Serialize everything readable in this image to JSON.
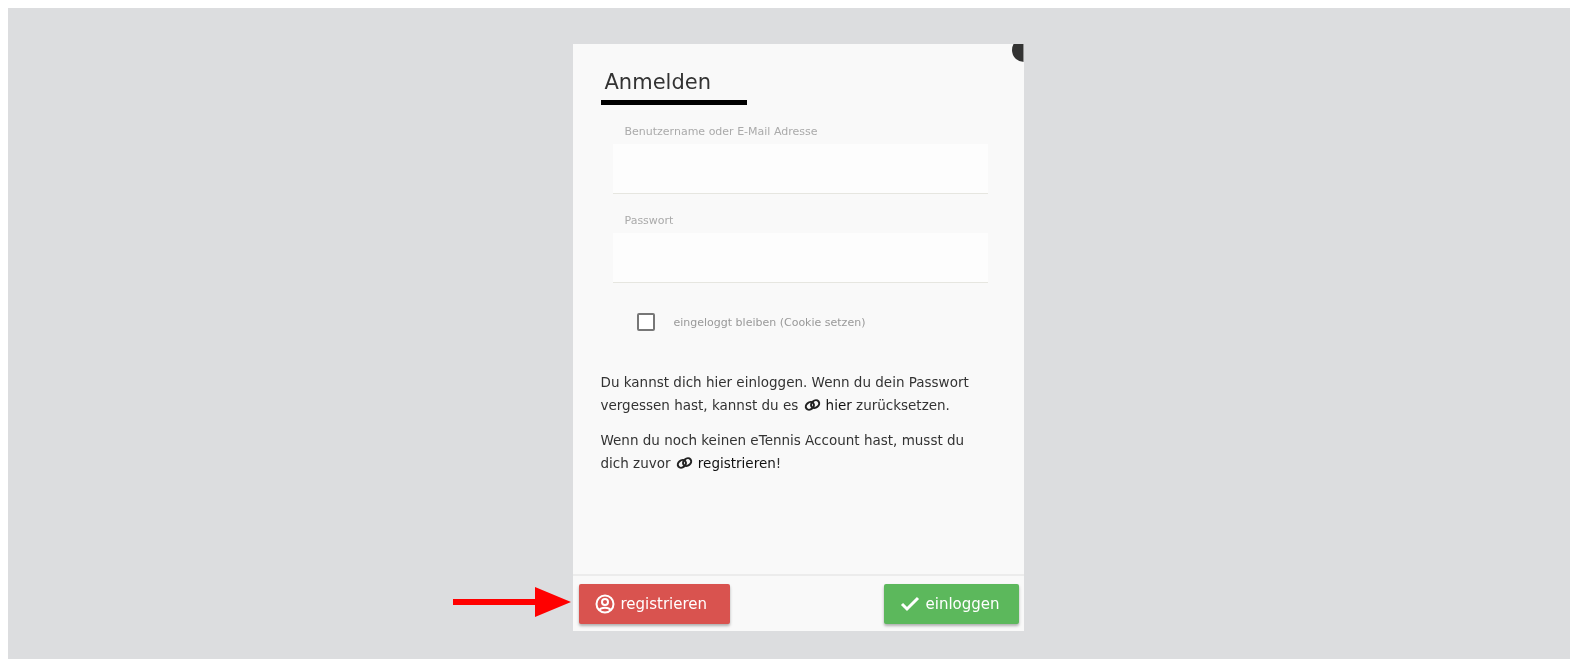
{
  "dialog": {
    "title": "Anmelden",
    "fields": [
      {
        "label": "Benutzername oder E-Mail Adresse"
      },
      {
        "label": "Passwort"
      }
    ],
    "remember": {
      "label": "eingeloggt bleiben (Cookie setzen)",
      "checked": false
    },
    "paragraphs": [
      [
        {
          "kind": "text",
          "text": "Du kannst dich hier einloggen. Wenn du dein Passwort vergessen hast, kannst du es "
        },
        {
          "kind": "link",
          "text": "hier"
        },
        {
          "kind": "text",
          "text": " zurücksetzen."
        }
      ],
      [
        {
          "kind": "text",
          "text": "Wenn du noch keinen eTennis Account hast, musst du dich zuvor "
        },
        {
          "kind": "link",
          "text": "registrieren"
        },
        {
          "kind": "text",
          "text": "!"
        }
      ]
    ],
    "buttons": [
      {
        "label": "registrieren",
        "kind": "register"
      },
      {
        "label": "einloggen",
        "kind": "login"
      }
    ]
  }
}
